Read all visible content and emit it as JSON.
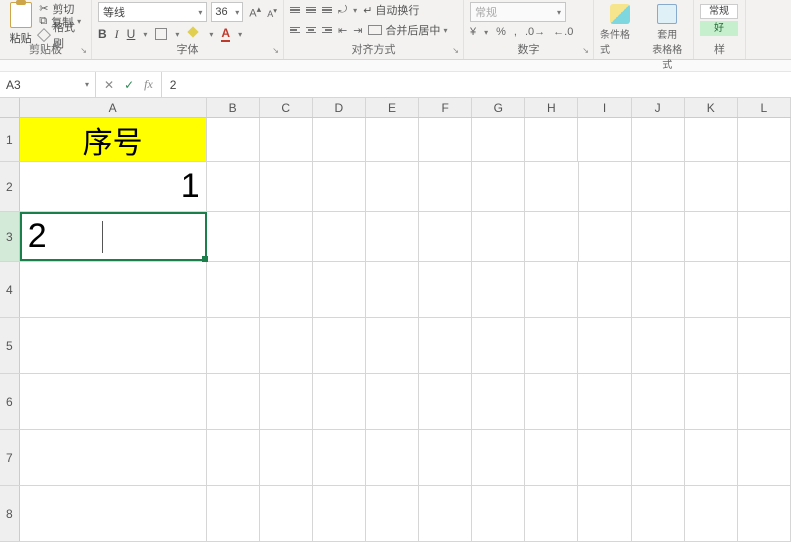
{
  "clipboard": {
    "paste": "粘贴",
    "cut": "剪切",
    "copy": "复制",
    "format_painter": "格式刷",
    "label": "剪贴板"
  },
  "font": {
    "name": "等线",
    "size": "36",
    "bold": "B",
    "italic": "I",
    "underline": "U",
    "font_color": "A",
    "label": "字体"
  },
  "align": {
    "wrap": "自动换行",
    "merge": "合并后居中",
    "label": "对齐方式"
  },
  "number": {
    "format": "常规",
    "percent": "%",
    "comma": ",",
    "inc": ".0",
    "dec": ".00",
    "label": "数字"
  },
  "styles": {
    "conditional": "条件格式",
    "as_table": "套用\n表格格式",
    "normal": "常规",
    "good": "好",
    "label": "样"
  },
  "formula_bar": {
    "name_box": "A3",
    "cancel": "✕",
    "enter": "✓",
    "value": "2"
  },
  "columns": [
    "A",
    "B",
    "C",
    "D",
    "E",
    "F",
    "G",
    "H",
    "I",
    "J",
    "K",
    "L"
  ],
  "rows": [
    "1",
    "2",
    "3",
    "4",
    "5",
    "6",
    "7",
    "8"
  ],
  "cells": {
    "A1": "序号",
    "A2": "1",
    "A3": "2"
  }
}
